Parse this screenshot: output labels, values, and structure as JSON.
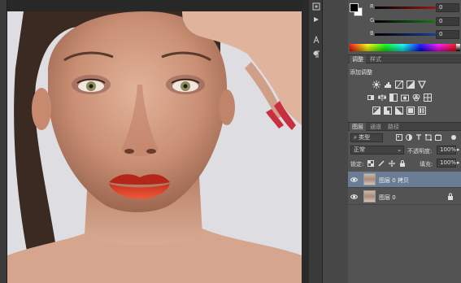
{
  "color_panel": {
    "channels": [
      {
        "label": "R",
        "value": "0",
        "color": "#c82020"
      },
      {
        "label": "G",
        "value": "0",
        "color": "#20a020"
      },
      {
        "label": "B",
        "value": "0",
        "color": "#2050d0"
      }
    ]
  },
  "adjust_tabs": [
    "调整",
    "样式"
  ],
  "adjust_title": "添加调整",
  "adjust_icons": [
    "brightness-contrast-icon",
    "levels-icon",
    "curves-icon",
    "exposure-icon",
    "vibrance-icon",
    "hue-saturation-icon",
    "color-balance-icon",
    "black-white-icon",
    "photo-filter-icon",
    "channel-mixer-icon",
    "color-lookup-icon",
    "invert-icon",
    "posterize-icon",
    "threshold-icon",
    "selective-color-icon",
    "gradient-map-icon"
  ],
  "layers_tabs": [
    "图层",
    "通道",
    "路径"
  ],
  "layers": {
    "filter_kind": "类型",
    "blend_mode": "正常",
    "opacity_label": "不透明度:",
    "opacity_value": "100%",
    "lock_label": "锁定:",
    "fill_label": "填充:",
    "fill_value": "100%",
    "items": [
      {
        "name": "图层 0 拷贝",
        "selected": true,
        "locked": false
      },
      {
        "name": "图层 0",
        "selected": false,
        "locked": true
      }
    ]
  }
}
